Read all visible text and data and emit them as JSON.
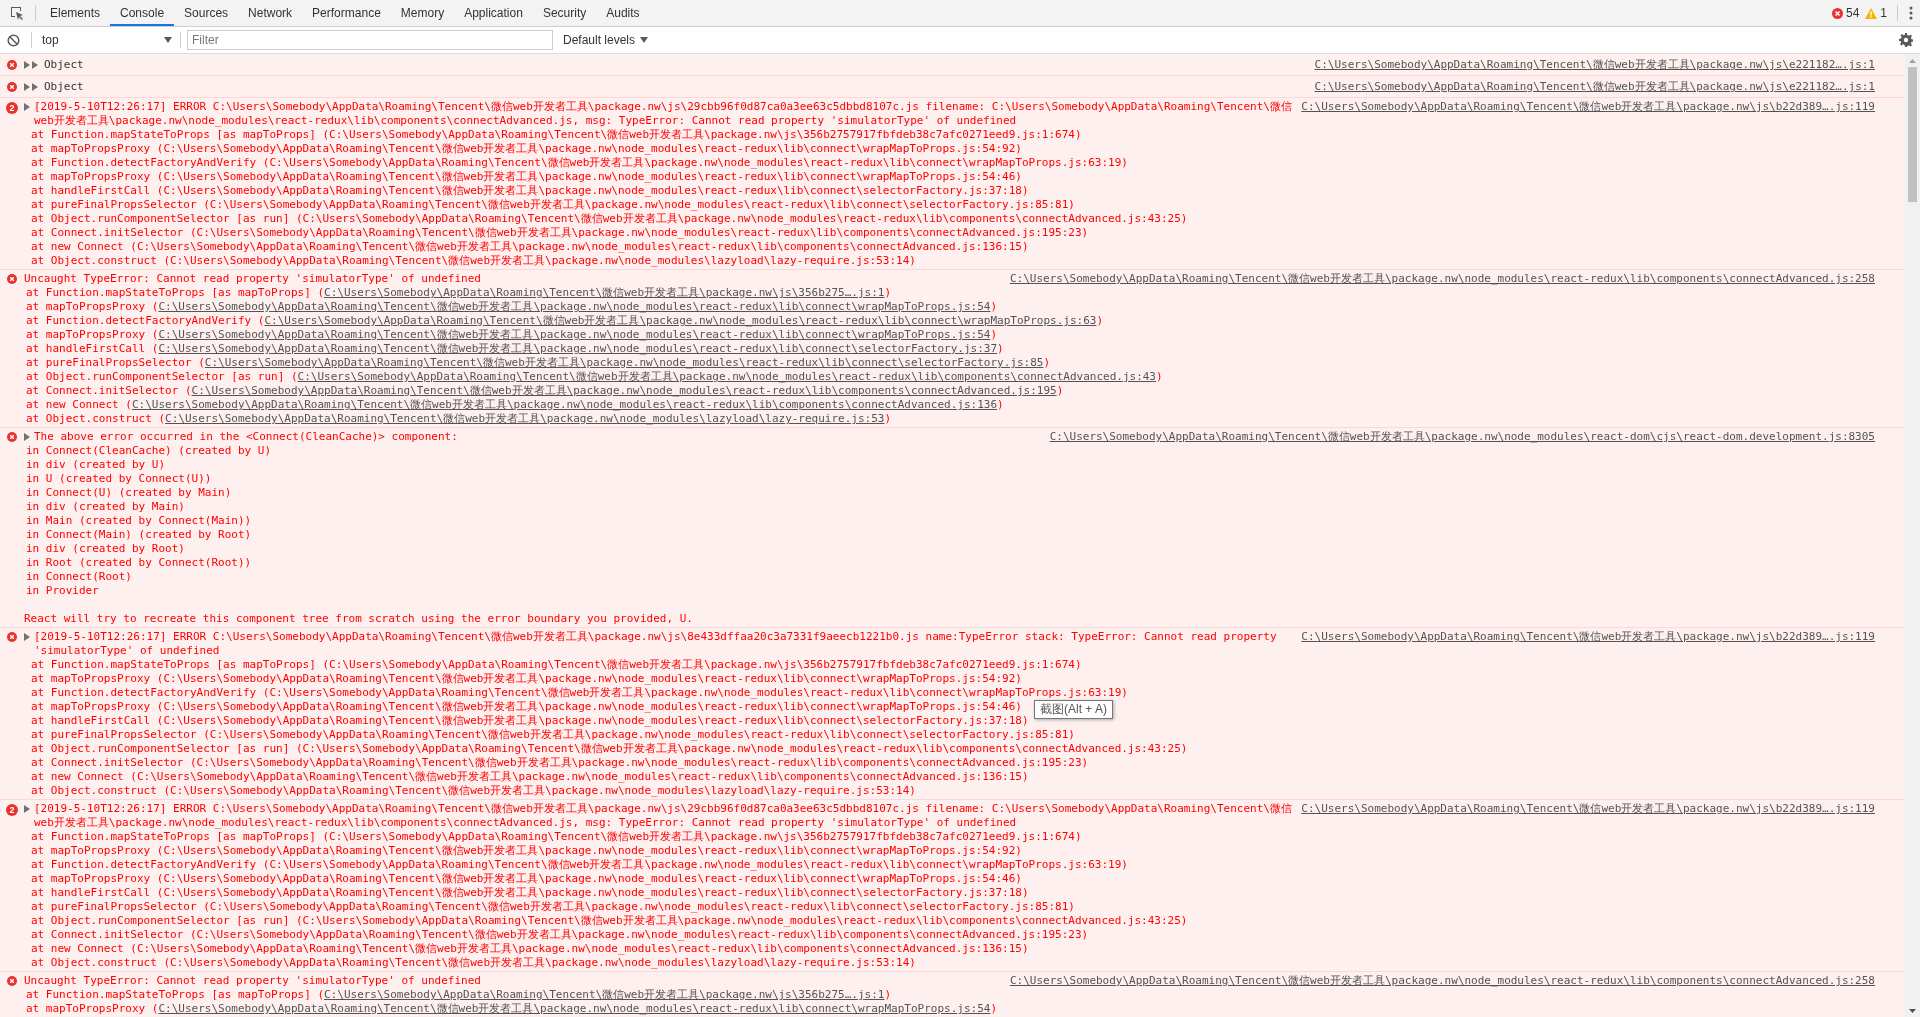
{
  "toolbar": {
    "tabs": [
      {
        "label": "Elements",
        "selected": false
      },
      {
        "label": "Console",
        "selected": true
      },
      {
        "label": "Sources",
        "selected": false
      },
      {
        "label": "Network",
        "selected": false
      },
      {
        "label": "Performance",
        "selected": false
      },
      {
        "label": "Memory",
        "selected": false
      },
      {
        "label": "Application",
        "selected": false
      },
      {
        "label": "Security",
        "selected": false
      },
      {
        "label": "Audits",
        "selected": false
      }
    ],
    "errors": "54",
    "warnings": "1"
  },
  "filter_bar": {
    "context": "top",
    "placeholder": "Filter",
    "levels": "Default levels"
  },
  "messages": [
    {
      "kind": "object",
      "text": "Object",
      "source": "C:\\Users\\Somebody\\AppData\\Roaming\\Tencent\\微信web开发者工具\\package.nw\\js\\e221182….js:1"
    },
    {
      "kind": "object",
      "text": "Object",
      "source": "C:\\Users\\Somebody\\AppData\\Roaming\\Tencent\\微信web开发者工具\\package.nw\\js\\e221182….js:1"
    },
    {
      "kind": "log",
      "count": "2",
      "expandable": true,
      "text": "[2019-5-10T12:26:17] ERROR C:\\Users\\Somebody\\AppData\\Roaming\\Tencent\\微信web开发者工具\\package.nw\\js\\29cbb96f0d87ca0a3ee63c5dbbd8107c.js filename: C:\\Users\\Somebody\\AppData\\Roaming\\Tencent\\微信web开发者工具\\package.nw\\node_modules\\react-redux\\lib\\components\\connectAdvanced.js, msg: TypeError: Cannot read property 'simulatorType' of undefined",
      "source": "C:\\Users\\Somebody\\AppData\\Roaming\\Tencent\\微信web开发者工具\\package.nw\\js\\b22d389….js:119",
      "frames": [
        {
          "text": "at Function.mapStateToProps [as mapToProps] (C:\\Users\\Somebody\\AppData\\Roaming\\Tencent\\微信web开发者工具\\package.nw\\js\\356b2757917fbfdeb38c7afc0271eed9.js:1:674)"
        },
        {
          "text": "at mapToPropsProxy (C:\\Users\\Somebody\\AppData\\Roaming\\Tencent\\微信web开发者工具\\package.nw\\node_modules\\react-redux\\lib\\connect\\wrapMapToProps.js:54:92)"
        },
        {
          "text": "at Function.detectFactoryAndVerify (C:\\Users\\Somebody\\AppData\\Roaming\\Tencent\\微信web开发者工具\\package.nw\\node_modules\\react-redux\\lib\\connect\\wrapMapToProps.js:63:19)"
        },
        {
          "text": "at mapToPropsProxy (C:\\Users\\Somebody\\AppData\\Roaming\\Tencent\\微信web开发者工具\\package.nw\\node_modules\\react-redux\\lib\\connect\\wrapMapToProps.js:54:46)"
        },
        {
          "text": "at handleFirstCall (C:\\Users\\Somebody\\AppData\\Roaming\\Tencent\\微信web开发者工具\\package.nw\\node_modules\\react-redux\\lib\\connect\\selectorFactory.js:37:18)"
        },
        {
          "text": "at pureFinalPropsSelector (C:\\Users\\Somebody\\AppData\\Roaming\\Tencent\\微信web开发者工具\\package.nw\\node_modules\\react-redux\\lib\\connect\\selectorFactory.js:85:81)"
        },
        {
          "text": "at Object.runComponentSelector [as run] (C:\\Users\\Somebody\\AppData\\Roaming\\Tencent\\微信web开发者工具\\package.nw\\node_modules\\react-redux\\lib\\components\\connectAdvanced.js:43:25)"
        },
        {
          "text": "at Connect.initSelector (C:\\Users\\Somebody\\AppData\\Roaming\\Tencent\\微信web开发者工具\\package.nw\\node_modules\\react-redux\\lib\\components\\connectAdvanced.js:195:23)"
        },
        {
          "text": "at new Connect (C:\\Users\\Somebody\\AppData\\Roaming\\Tencent\\微信web开发者工具\\package.nw\\node_modules\\react-redux\\lib\\components\\connectAdvanced.js:136:15)"
        },
        {
          "text": "at Object.construct (C:\\Users\\Somebody\\AppData\\Roaming\\Tencent\\微信web开发者工具\\package.nw\\node_modules\\lazyload\\lazy-require.js:53:14)"
        }
      ]
    },
    {
      "kind": "uncaught",
      "text": "Uncaught TypeError: Cannot read property 'simulatorType' of undefined",
      "source": "C:\\Users\\Somebody\\AppData\\Roaming\\Tencent\\微信web开发者工具\\package.nw\\node_modules\\react-redux\\lib\\components\\connectAdvanced.js:258",
      "frames": [
        {
          "text": "at Function.mapStateToProps [as mapToProps] (",
          "link": "C:\\Users\\Somebody\\AppData\\Roaming\\Tencent\\微信web开发者工具\\package.nw\\js\\356b275….js:1",
          "after": ")"
        },
        {
          "text": "at mapToPropsProxy (",
          "link": "C:\\Users\\Somebody\\AppData\\Roaming\\Tencent\\微信web开发者工具\\package.nw\\node_modules\\react-redux\\lib\\connect\\wrapMapToProps.js:54",
          "after": ")"
        },
        {
          "text": "at Function.detectFactoryAndVerify (",
          "link": "C:\\Users\\Somebody\\AppData\\Roaming\\Tencent\\微信web开发者工具\\package.nw\\node_modules\\react-redux\\lib\\connect\\wrapMapToProps.js:63",
          "after": ")"
        },
        {
          "text": "at mapToPropsProxy (",
          "link": "C:\\Users\\Somebody\\AppData\\Roaming\\Tencent\\微信web开发者工具\\package.nw\\node_modules\\react-redux\\lib\\connect\\wrapMapToProps.js:54",
          "after": ")"
        },
        {
          "text": "at handleFirstCall (",
          "link": "C:\\Users\\Somebody\\AppData\\Roaming\\Tencent\\微信web开发者工具\\package.nw\\node_modules\\react-redux\\lib\\connect\\selectorFactory.js:37",
          "after": ")"
        },
        {
          "text": "at pureFinalPropsSelector (",
          "link": "C:\\Users\\Somebody\\AppData\\Roaming\\Tencent\\微信web开发者工具\\package.nw\\node_modules\\react-redux\\lib\\connect\\selectorFactory.js:85",
          "after": ")"
        },
        {
          "text": "at Object.runComponentSelector [as run] (",
          "link": "C:\\Users\\Somebody\\AppData\\Roaming\\Tencent\\微信web开发者工具\\package.nw\\node_modules\\react-redux\\lib\\components\\connectAdvanced.js:43",
          "after": ")"
        },
        {
          "text": "at Connect.initSelector (",
          "link": "C:\\Users\\Somebody\\AppData\\Roaming\\Tencent\\微信web开发者工具\\package.nw\\node_modules\\react-redux\\lib\\components\\connectAdvanced.js:195",
          "after": ")"
        },
        {
          "text": "at new Connect (",
          "link": "C:\\Users\\Somebody\\AppData\\Roaming\\Tencent\\微信web开发者工具\\package.nw\\node_modules\\react-redux\\lib\\components\\connectAdvanced.js:136",
          "after": ")"
        },
        {
          "text": "at Object.construct (",
          "link": "C:\\Users\\Somebody\\AppData\\Roaming\\Tencent\\微信web开发者工具\\package.nw\\node_modules\\lazyload\\lazy-require.js:53",
          "after": ")"
        }
      ]
    },
    {
      "kind": "react",
      "expandable": true,
      "text": "The above error occurred in the <Connect(CleanCache)> component:",
      "source": "C:\\Users\\Somebody\\AppData\\Roaming\\Tencent\\微信web开发者工具\\package.nw\\node_modules\\react-dom\\cjs\\react-dom.development.js:8305",
      "lines": [
        "in Connect(CleanCache) (created by U)",
        "in div (created by U)",
        "in U (created by Connect(U))",
        "in Connect(U) (created by Main)",
        "in div (created by Main)",
        "in Main (created by Connect(Main))",
        "in Connect(Main) (created by Root)",
        "in div (created by Root)",
        "in Root (created by Connect(Root))",
        "in Connect(Root)",
        "in Provider"
      ],
      "note": "React will try to recreate this component tree from scratch using the error boundary you provided, U."
    },
    {
      "kind": "log",
      "expandable": true,
      "text": "[2019-5-10T12:26:17] ERROR C:\\Users\\Somebody\\AppData\\Roaming\\Tencent\\微信web开发者工具\\package.nw\\js\\8e433dffaa20c3a7331f9aeecb1221b0.js name:TypeError stack: TypeError: Cannot read property 'simulatorType' of undefined",
      "source": "C:\\Users\\Somebody\\AppData\\Roaming\\Tencent\\微信web开发者工具\\package.nw\\js\\b22d389….js:119",
      "frames": [
        {
          "text": "at Function.mapStateToProps [as mapToProps] (C:\\Users\\Somebody\\AppData\\Roaming\\Tencent\\微信web开发者工具\\package.nw\\js\\356b2757917fbfdeb38c7afc0271eed9.js:1:674)"
        },
        {
          "text": "at mapToPropsProxy (C:\\Users\\Somebody\\AppData\\Roaming\\Tencent\\微信web开发者工具\\package.nw\\node_modules\\react-redux\\lib\\connect\\wrapMapToProps.js:54:92)"
        },
        {
          "text": "at Function.detectFactoryAndVerify (C:\\Users\\Somebody\\AppData\\Roaming\\Tencent\\微信web开发者工具\\package.nw\\node_modules\\react-redux\\lib\\connect\\wrapMapToProps.js:63:19)"
        },
        {
          "text": "at mapToPropsProxy (C:\\Users\\Somebody\\AppData\\Roaming\\Tencent\\微信web开发者工具\\package.nw\\node_modules\\react-redux\\lib\\connect\\wrapMapToProps.js:54:46)",
          "tooltip": "截图(Alt + A)"
        },
        {
          "text": "at handleFirstCall (C:\\Users\\Somebody\\AppData\\Roaming\\Tencent\\微信web开发者工具\\package.nw\\node_modules\\react-redux\\lib\\connect\\selectorFactory.js:37:18)"
        },
        {
          "text": "at pureFinalPropsSelector (C:\\Users\\Somebody\\AppData\\Roaming\\Tencent\\微信web开发者工具\\package.nw\\node_modules\\react-redux\\lib\\connect\\selectorFactory.js:85:81)"
        },
        {
          "text": "at Object.runComponentSelector [as run] (C:\\Users\\Somebody\\AppData\\Roaming\\Tencent\\微信web开发者工具\\package.nw\\node_modules\\react-redux\\lib\\components\\connectAdvanced.js:43:25)"
        },
        {
          "text": "at Connect.initSelector (C:\\Users\\Somebody\\AppData\\Roaming\\Tencent\\微信web开发者工具\\package.nw\\node_modules\\react-redux\\lib\\components\\connectAdvanced.js:195:23)"
        },
        {
          "text": "at new Connect (C:\\Users\\Somebody\\AppData\\Roaming\\Tencent\\微信web开发者工具\\package.nw\\node_modules\\react-redux\\lib\\components\\connectAdvanced.js:136:15)"
        },
        {
          "text": "at Object.construct (C:\\Users\\Somebody\\AppData\\Roaming\\Tencent\\微信web开发者工具\\package.nw\\node_modules\\lazyload\\lazy-require.js:53:14)"
        }
      ]
    },
    {
      "kind": "log",
      "count": "2",
      "expandable": true,
      "text": "[2019-5-10T12:26:17] ERROR C:\\Users\\Somebody\\AppData\\Roaming\\Tencent\\微信web开发者工具\\package.nw\\js\\29cbb96f0d87ca0a3ee63c5dbbd8107c.js filename: C:\\Users\\Somebody\\AppData\\Roaming\\Tencent\\微信web开发者工具\\package.nw\\node_modules\\react-redux\\lib\\components\\connectAdvanced.js, msg: TypeError: Cannot read property 'simulatorType' of undefined",
      "source": "C:\\Users\\Somebody\\AppData\\Roaming\\Tencent\\微信web开发者工具\\package.nw\\js\\b22d389….js:119",
      "frames": [
        {
          "text": "at Function.mapStateToProps [as mapToProps] (C:\\Users\\Somebody\\AppData\\Roaming\\Tencent\\微信web开发者工具\\package.nw\\js\\356b2757917fbfdeb38c7afc0271eed9.js:1:674)"
        },
        {
          "text": "at mapToPropsProxy (C:\\Users\\Somebody\\AppData\\Roaming\\Tencent\\微信web开发者工具\\package.nw\\node_modules\\react-redux\\lib\\connect\\wrapMapToProps.js:54:92)"
        },
        {
          "text": "at Function.detectFactoryAndVerify (C:\\Users\\Somebody\\AppData\\Roaming\\Tencent\\微信web开发者工具\\package.nw\\node_modules\\react-redux\\lib\\connect\\wrapMapToProps.js:63:19)"
        },
        {
          "text": "at mapToPropsProxy (C:\\Users\\Somebody\\AppData\\Roaming\\Tencent\\微信web开发者工具\\package.nw\\node_modules\\react-redux\\lib\\connect\\wrapMapToProps.js:54:46)"
        },
        {
          "text": "at handleFirstCall (C:\\Users\\Somebody\\AppData\\Roaming\\Tencent\\微信web开发者工具\\package.nw\\node_modules\\react-redux\\lib\\connect\\selectorFactory.js:37:18)"
        },
        {
          "text": "at pureFinalPropsSelector (C:\\Users\\Somebody\\AppData\\Roaming\\Tencent\\微信web开发者工具\\package.nw\\node_modules\\react-redux\\lib\\connect\\selectorFactory.js:85:81)"
        },
        {
          "text": "at Object.runComponentSelector [as run] (C:\\Users\\Somebody\\AppData\\Roaming\\Tencent\\微信web开发者工具\\package.nw\\node_modules\\react-redux\\lib\\components\\connectAdvanced.js:43:25)"
        },
        {
          "text": "at Connect.initSelector (C:\\Users\\Somebody\\AppData\\Roaming\\Tencent\\微信web开发者工具\\package.nw\\node_modules\\react-redux\\lib\\components\\connectAdvanced.js:195:23)"
        },
        {
          "text": "at new Connect (C:\\Users\\Somebody\\AppData\\Roaming\\Tencent\\微信web开发者工具\\package.nw\\node_modules\\react-redux\\lib\\components\\connectAdvanced.js:136:15)"
        },
        {
          "text": "at Object.construct (C:\\Users\\Somebody\\AppData\\Roaming\\Tencent\\微信web开发者工具\\package.nw\\node_modules\\lazyload\\lazy-require.js:53:14)"
        }
      ]
    },
    {
      "kind": "uncaught",
      "text": "Uncaught TypeError: Cannot read property 'simulatorType' of undefined",
      "source": "C:\\Users\\Somebody\\AppData\\Roaming\\Tencent\\微信web开发者工具\\package.nw\\node_modules\\react-redux\\lib\\components\\connectAdvanced.js:258",
      "frames": [
        {
          "text": "at Function.mapStateToProps [as mapToProps] (",
          "link": "C:\\Users\\Somebody\\AppData\\Roaming\\Tencent\\微信web开发者工具\\package.nw\\js\\356b275….js:1",
          "after": ")"
        },
        {
          "text": "at mapToPropsProxy (",
          "link": "C:\\Users\\Somebody\\AppData\\Roaming\\Tencent\\微信web开发者工具\\package.nw\\node_modules\\react-redux\\lib\\connect\\wrapMapToProps.js:54",
          "after": ")"
        }
      ]
    }
  ]
}
